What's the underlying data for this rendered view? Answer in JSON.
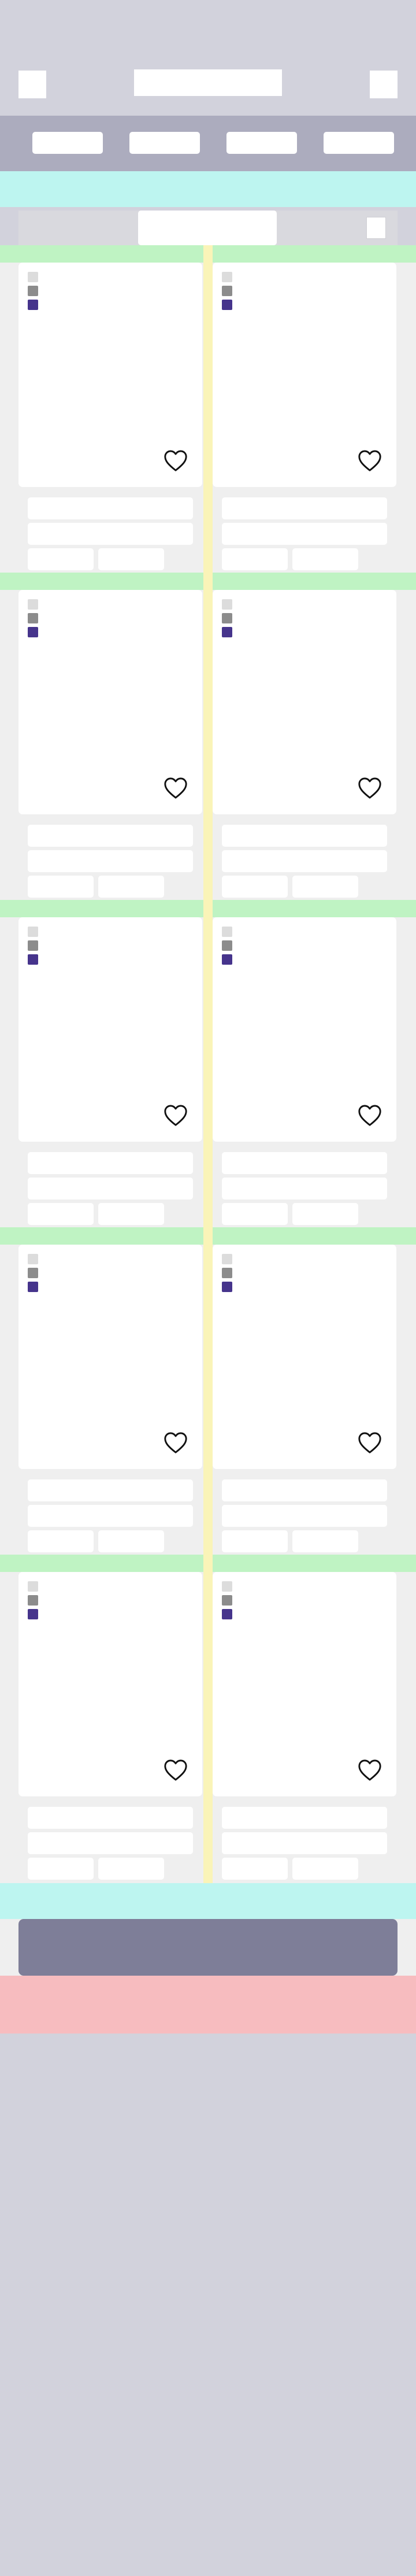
{
  "header": {
    "menu_icon": "menu-icon",
    "logo": "logo",
    "cart_icon": "cart-icon"
  },
  "nav": {
    "item_count": 4
  },
  "filter": {
    "checkbox": "filter-checkbox"
  },
  "products": {
    "rows": 5,
    "columns": 2,
    "swatch_colors": [
      "#dcdcdc",
      "#8c8c8c",
      "#46348c"
    ],
    "favorite_icon": "heart-icon"
  },
  "colors": {
    "header_bg": "#d2d2dc",
    "nav_bg": "#acacbe",
    "cyan_band": "#bdf5f0",
    "green_band": "#bff3c3",
    "yellow_divider": "#faf4b8",
    "grid_bg": "#efefef",
    "cta_bg": "#7e7e98",
    "pink_band": "#f7bcbf",
    "swatch_light": "#dcdcdc",
    "swatch_mid": "#8c8c8c",
    "swatch_dark": "#46348c"
  }
}
